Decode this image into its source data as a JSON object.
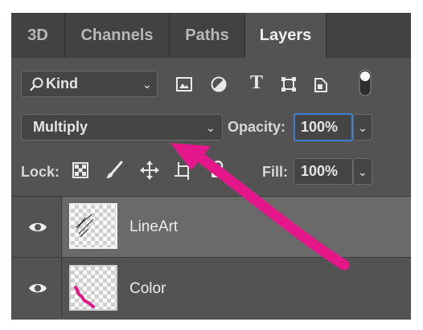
{
  "tabs": [
    {
      "label": "3D",
      "active": false
    },
    {
      "label": "Channels",
      "active": false
    },
    {
      "label": "Paths",
      "active": false
    },
    {
      "label": "Layers",
      "active": true
    }
  ],
  "filter": {
    "kind_label": "Kind",
    "icons": [
      "image-filter-icon",
      "adjustment-filter-icon",
      "type-filter-icon",
      "shape-filter-icon",
      "smart-object-filter-icon",
      "filter-toggle-icon"
    ]
  },
  "blend": {
    "mode": "Multiply",
    "opacity_label": "Opacity:",
    "opacity_value": "100%"
  },
  "lock": {
    "label": "Lock:",
    "icons": [
      "lock-transparent-pixels-icon",
      "lock-image-pixels-icon",
      "lock-position-icon",
      "lock-artboard-icon",
      "lock-all-icon"
    ],
    "fill_label": "Fill:",
    "fill_value": "100%"
  },
  "layers": [
    {
      "name": "LineArt",
      "visible": true,
      "selected": true
    },
    {
      "name": "Color",
      "visible": true,
      "selected": false
    }
  ],
  "annotation": {
    "arrow_color": "#e5168a"
  }
}
